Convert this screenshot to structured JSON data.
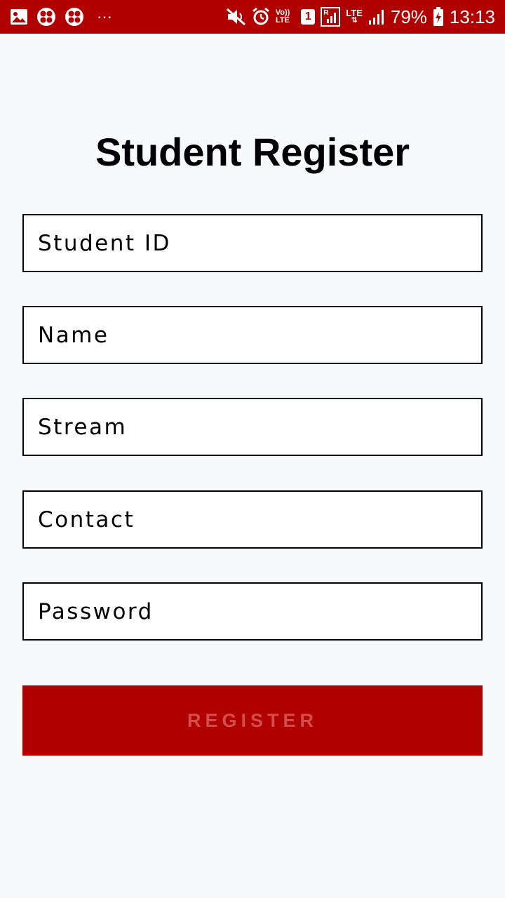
{
  "status_bar": {
    "left_icons": [
      "image-icon",
      "app-icon",
      "app-icon",
      "more-dots-icon"
    ],
    "more_text": "···",
    "volte_top": "Vo))",
    "volte_bottom": "LTE",
    "sim_badge": "1",
    "roaming_letter": "R",
    "lte_label": "LTE",
    "battery_percent": "79%",
    "time": "13:13"
  },
  "page": {
    "title": "Student Register"
  },
  "form": {
    "student_id_placeholder": "Student ID",
    "name_placeholder": "Name",
    "stream_placeholder": "Stream",
    "contact_placeholder": "Contact",
    "password_placeholder": "Password",
    "register_label": "REGISTER"
  },
  "colors": {
    "accent": "#b00000",
    "button_text": "#d44d4d",
    "background": "#f8f9fa"
  }
}
